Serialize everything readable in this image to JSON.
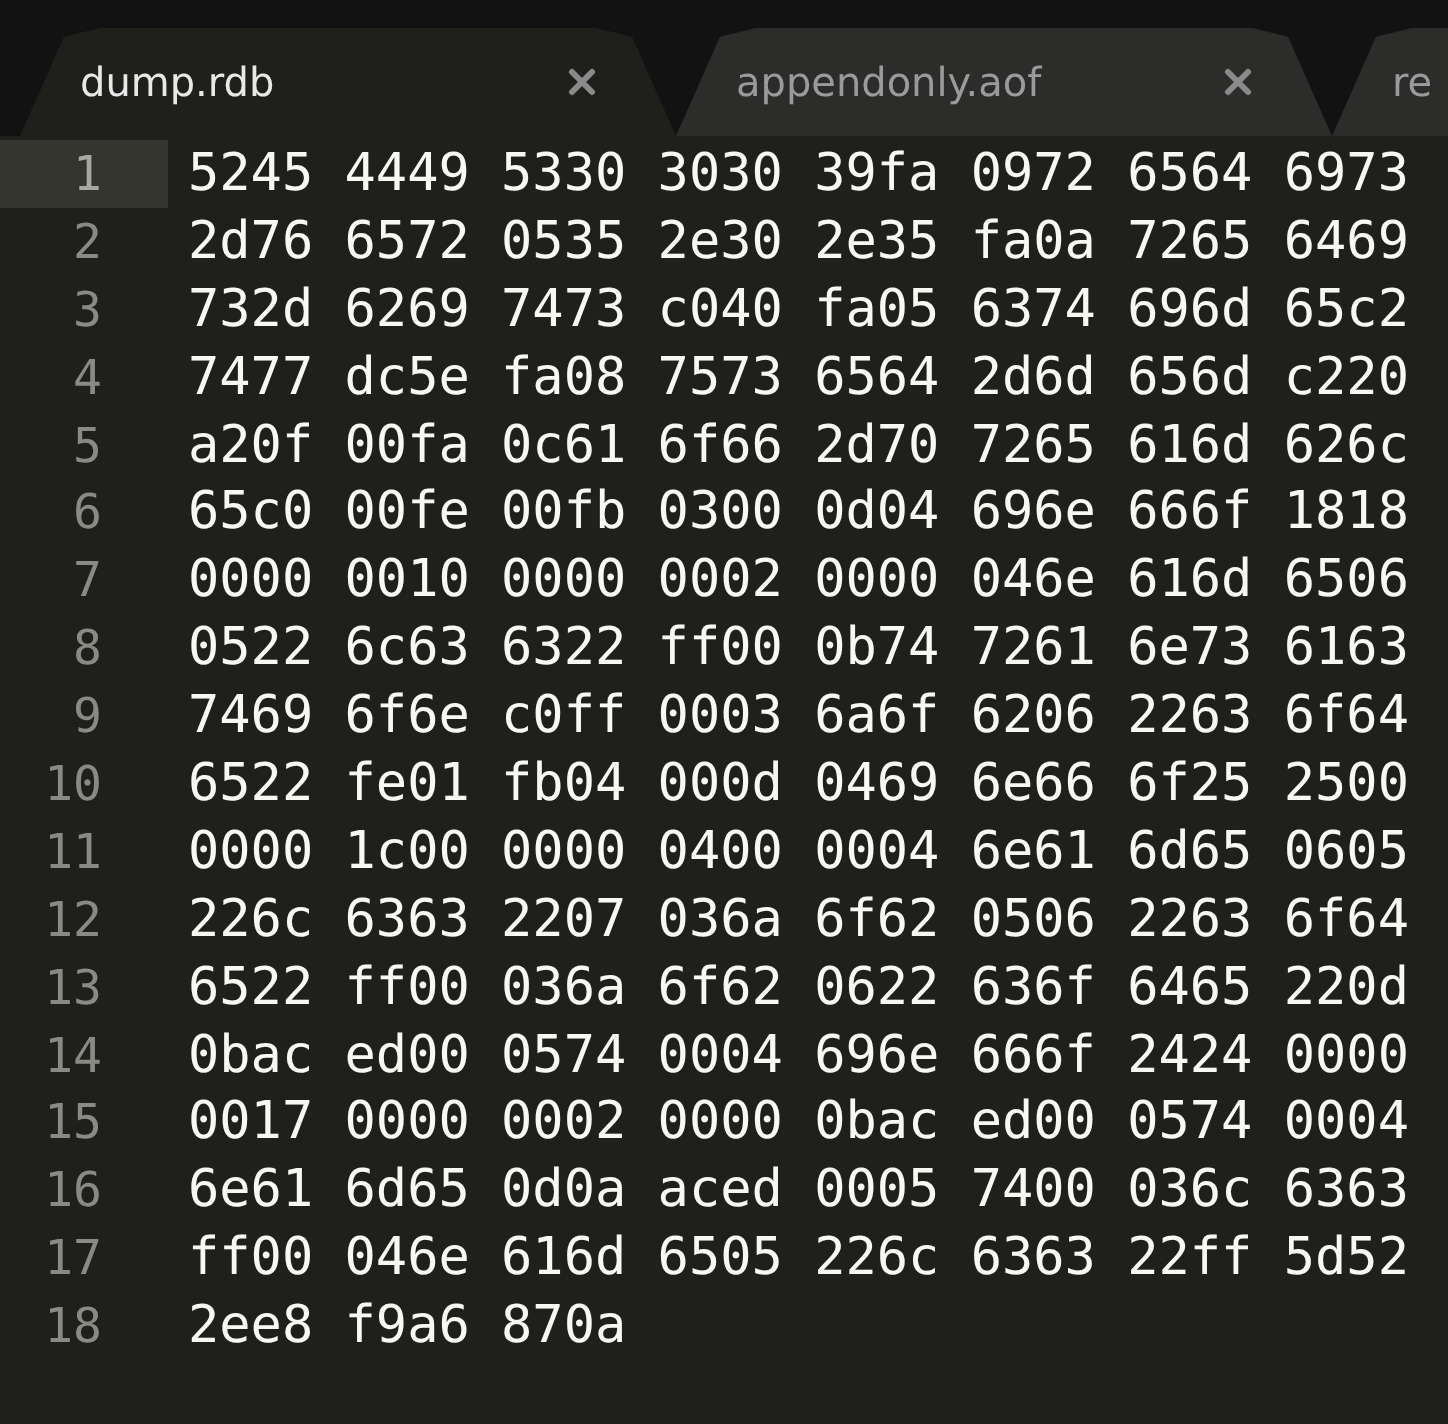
{
  "tabs": [
    {
      "label": "dump.rdb",
      "selected": true,
      "closable": true
    },
    {
      "label": "appendonly.aof",
      "selected": false,
      "closable": true
    },
    {
      "label": "re",
      "selected": false,
      "closable": false
    }
  ],
  "editor": {
    "lines": [
      {
        "number": "1",
        "text": "5245 4449 5330 3030 39fa 0972 6564 6973",
        "current": true
      },
      {
        "number": "2",
        "text": "2d76 6572 0535 2e30 2e35 fa0a 7265 6469",
        "current": false
      },
      {
        "number": "3",
        "text": "732d 6269 7473 c040 fa05 6374 696d 65c2",
        "current": false
      },
      {
        "number": "4",
        "text": "7477 dc5e fa08 7573 6564 2d6d 656d c220",
        "current": false
      },
      {
        "number": "5",
        "text": "a20f 00fa 0c61 6f66 2d70 7265 616d 626c",
        "current": false
      },
      {
        "number": "6",
        "text": "65c0 00fe 00fb 0300 0d04 696e 666f 1818",
        "current": false
      },
      {
        "number": "7",
        "text": "0000 0010 0000 0002 0000 046e 616d 6506",
        "current": false
      },
      {
        "number": "8",
        "text": "0522 6c63 6322 ff00 0b74 7261 6e73 6163",
        "current": false
      },
      {
        "number": "9",
        "text": "7469 6f6e c0ff 0003 6a6f 6206 2263 6f64",
        "current": false
      },
      {
        "number": "10",
        "text": "6522 fe01 fb04 000d 0469 6e66 6f25 2500",
        "current": false
      },
      {
        "number": "11",
        "text": "0000 1c00 0000 0400 0004 6e61 6d65 0605",
        "current": false
      },
      {
        "number": "12",
        "text": "226c 6363 2207 036a 6f62 0506 2263 6f64",
        "current": false
      },
      {
        "number": "13",
        "text": "6522 ff00 036a 6f62 0622 636f 6465 220d",
        "current": false
      },
      {
        "number": "14",
        "text": "0bac ed00 0574 0004 696e 666f 2424 0000",
        "current": false
      },
      {
        "number": "15",
        "text": "0017 0000 0002 0000 0bac ed00 0574 0004",
        "current": false
      },
      {
        "number": "16",
        "text": "6e61 6d65 0d0a aced 0005 7400 036c 6363",
        "current": false
      },
      {
        "number": "17",
        "text": "ff00 046e 616d 6505 226c 6363 22ff 5d52",
        "current": false
      },
      {
        "number": "18",
        "text": "2ee8 f9a6 870a",
        "current": false
      }
    ]
  }
}
